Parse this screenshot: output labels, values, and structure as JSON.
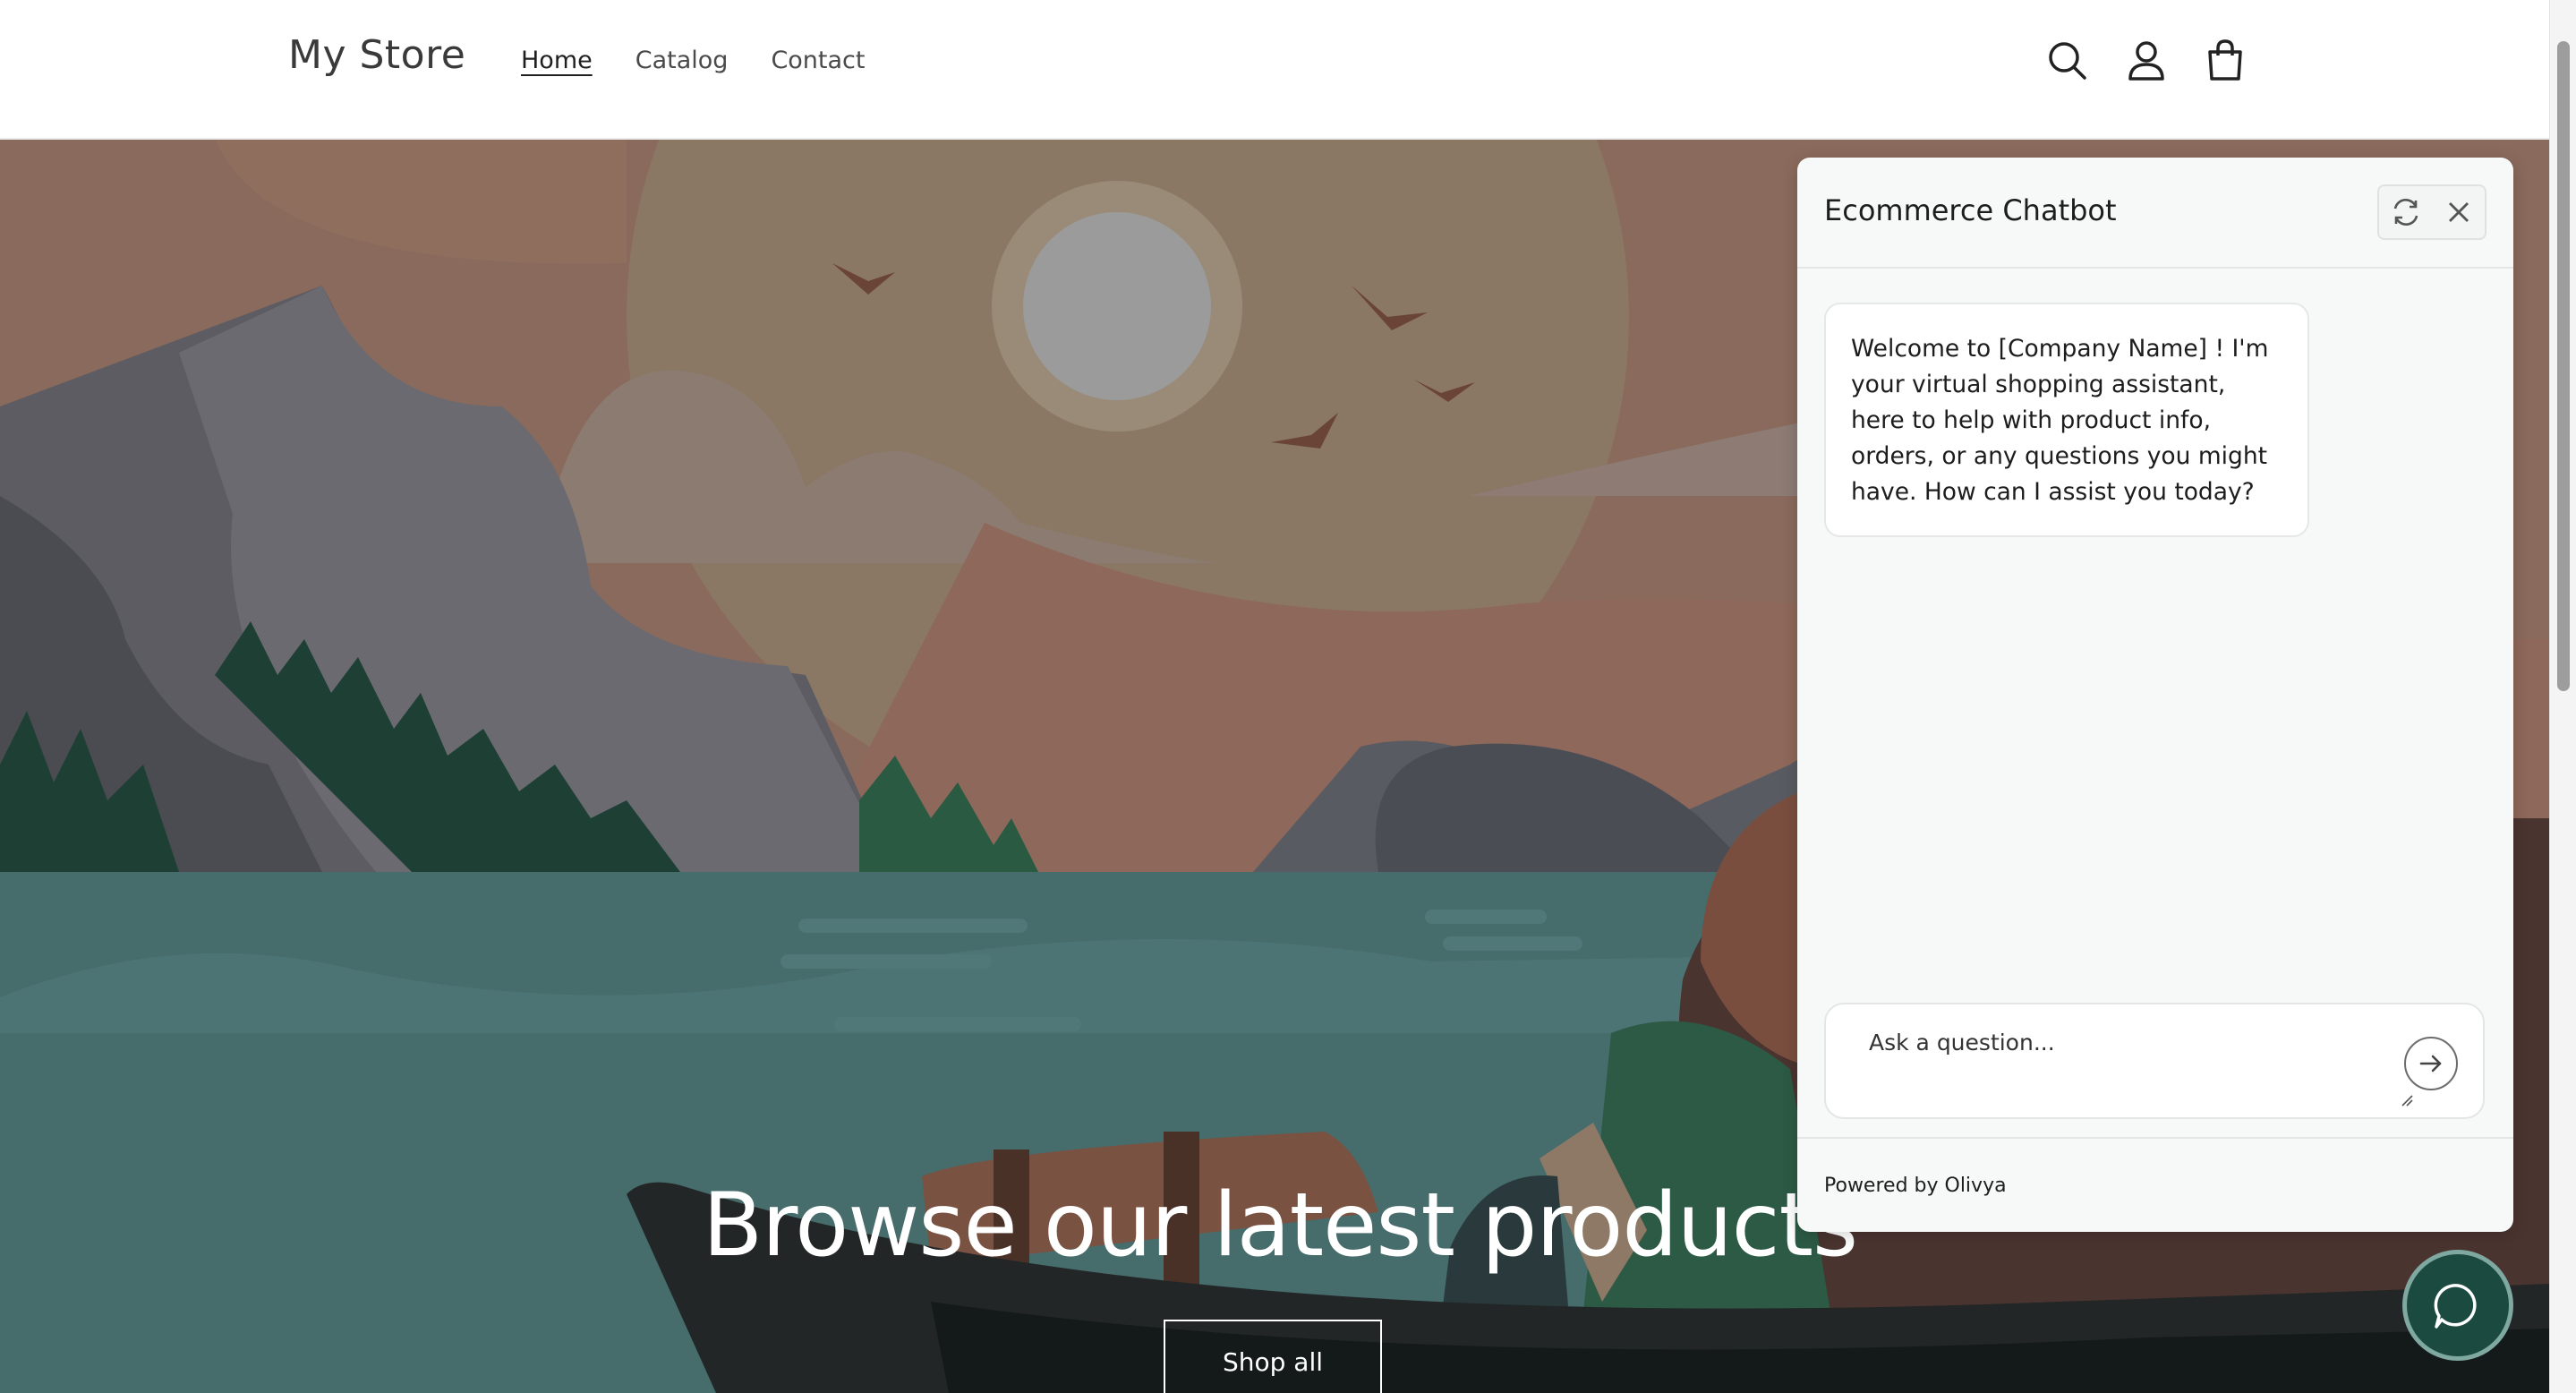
{
  "header": {
    "logo": "My Store",
    "nav": [
      {
        "label": "Home",
        "active": true
      },
      {
        "label": "Catalog",
        "active": false
      },
      {
        "label": "Contact",
        "active": false
      }
    ],
    "icons": [
      "search-icon",
      "account-icon",
      "cart-icon"
    ]
  },
  "hero": {
    "title": "Browse our latest products",
    "button_label": "Shop all"
  },
  "chatbot": {
    "title": "Ecommerce Chatbot",
    "actions": [
      "refresh-icon",
      "close-icon"
    ],
    "welcome_message": "Welcome to [Company Name] ! I'm your virtual shopping assistant, here to help with product info, orders, or any questions you might have. How can I assist you today?",
    "input_placeholder": "Ask a question...",
    "powered_by": "Powered by Olivya"
  },
  "launcher": {
    "icon": "chat-bubble-icon"
  },
  "colors": {
    "accent": "#1b4a40",
    "sky": "#8a6a5c",
    "water": "#466c6c"
  }
}
